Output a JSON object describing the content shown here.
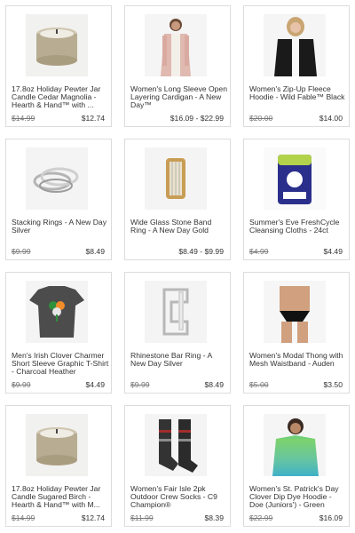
{
  "products": [
    {
      "title": "17.8oz Holiday Pewter Jar Candle Cedar Magnolia - Hearth & Hand™ with ...",
      "old_price": "$14.99",
      "price": "$12.74",
      "icon": "candle-jar-icon"
    },
    {
      "title": "Women's Long Sleeve Open Layering Cardigan - A New Day™",
      "old_price": "",
      "price": "$16.09 - $22.99",
      "icon": "cardigan-model-icon"
    },
    {
      "title": "Women's Zip-Up Fleece Hoodie - Wild Fable™ Black",
      "old_price": "$20.00",
      "price": "$14.00",
      "icon": "black-hoodie-model-icon"
    },
    {
      "title": "Stacking Rings - A New Day Silver",
      "old_price": "$9.99",
      "price": "$8.49",
      "icon": "stacking-rings-icon"
    },
    {
      "title": "Wide Glass Stone Band Ring - A New Day Gold",
      "old_price": "",
      "price": "$8.49 - $9.99",
      "icon": "gold-band-ring-icon"
    },
    {
      "title": "Summer's Eve FreshCycle Cleansing Cloths - 24ct",
      "old_price": "$4.99",
      "price": "$4.49",
      "icon": "cleansing-cloths-pack-icon"
    },
    {
      "title": "Men's Irish Clover Charmer Short Sleeve Graphic T-Shirt - Charcoal Heather",
      "old_price": "$9.99",
      "price": "$4.49",
      "icon": "clover-tshirt-icon"
    },
    {
      "title": "Rhinestone Bar Ring - A New Day Silver",
      "old_price": "$9.99",
      "price": "$8.49",
      "icon": "rhinestone-bar-ring-icon"
    },
    {
      "title": "Women's Modal Thong with Mesh Waistband - Auden",
      "old_price": "$5.00",
      "price": "$3.50",
      "icon": "thong-model-icon"
    },
    {
      "title": "17.8oz Holiday Pewter Jar Candle Sugared Birch - Hearth & Hand™ with M...",
      "old_price": "$14.99",
      "price": "$12.74",
      "icon": "candle-jar-icon"
    },
    {
      "title": "Women's Fair Isle 2pk Outdoor Crew Socks - C9 Champion®",
      "old_price": "$11.99",
      "price": "$8.39",
      "icon": "crew-socks-icon"
    },
    {
      "title": "Women's St. Patrick's Day Clover Dip Dye Hoodie - Doe (Juniors') - Green",
      "old_price": "$22.99",
      "price": "$16.09",
      "icon": "green-hoodie-model-icon"
    }
  ]
}
